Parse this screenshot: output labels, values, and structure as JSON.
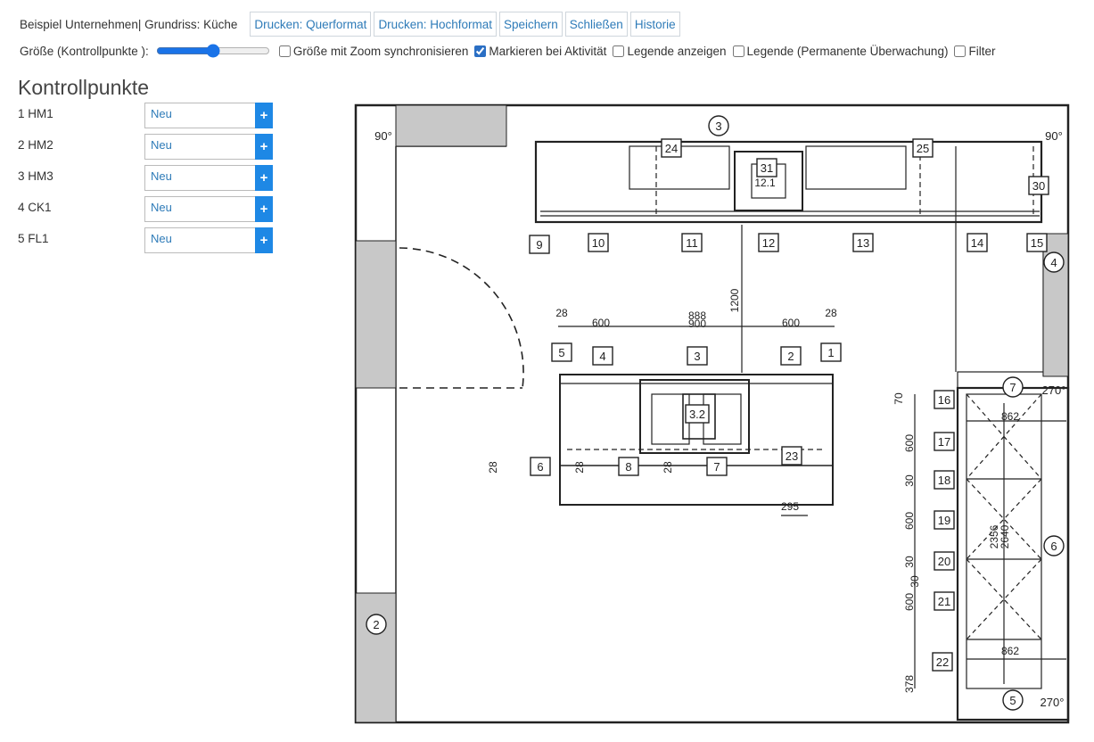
{
  "header": {
    "breadcrumb": "Beispiel Unternehmen| Grundriss: Küche",
    "buttons": [
      "Drucken: Querformat",
      "Drucken: Hochformat",
      "Speichern",
      "Schließen",
      "Historie"
    ]
  },
  "options": {
    "size_label": "Größe (Kontrollpunkte ):",
    "size_value": 50,
    "checkboxes": [
      {
        "label": "Größe mit Zoom synchronisieren",
        "checked": false
      },
      {
        "label": "Markieren bei Aktivität",
        "checked": true
      },
      {
        "label": "Legende anzeigen",
        "checked": false
      },
      {
        "label": "Legende (Permanente Überwachung)",
        "checked": false
      },
      {
        "label": "Filter",
        "checked": false
      }
    ]
  },
  "kontrollpunkte": {
    "title": "Kontrollpunkte",
    "add_label": "+",
    "items": [
      {
        "label": "1  HM1",
        "status": "Neu"
      },
      {
        "label": "2  HM2",
        "status": "Neu"
      },
      {
        "label": "3  HM3",
        "status": "Neu"
      },
      {
        "label": "4  CK1",
        "status": "Neu"
      },
      {
        "label": "5  FL1",
        "status": "Neu"
      }
    ]
  },
  "plan": {
    "boxes": [
      "24",
      "31",
      "25",
      "30",
      "9",
      "10",
      "11",
      "12",
      "13",
      "14",
      "15",
      "5",
      "4",
      "3",
      "2",
      "1",
      "3.2",
      "6",
      "8",
      "7",
      "23",
      "16",
      "17",
      "18",
      "19",
      "20",
      "21",
      "22"
    ],
    "circles": [
      "3",
      "4",
      "7",
      "6",
      "2",
      "5"
    ],
    "dimensions": [
      "28",
      "600",
      "888",
      "900",
      "600",
      "28",
      "1200",
      "12.1",
      "70",
      "600",
      "30",
      "600",
      "30",
      "600",
      "378",
      "862",
      "2356",
      "2640",
      "862",
      "28",
      "28",
      "28",
      "295",
      "30"
    ],
    "angles": [
      "90°",
      "90°",
      "270°",
      "270°"
    ]
  }
}
